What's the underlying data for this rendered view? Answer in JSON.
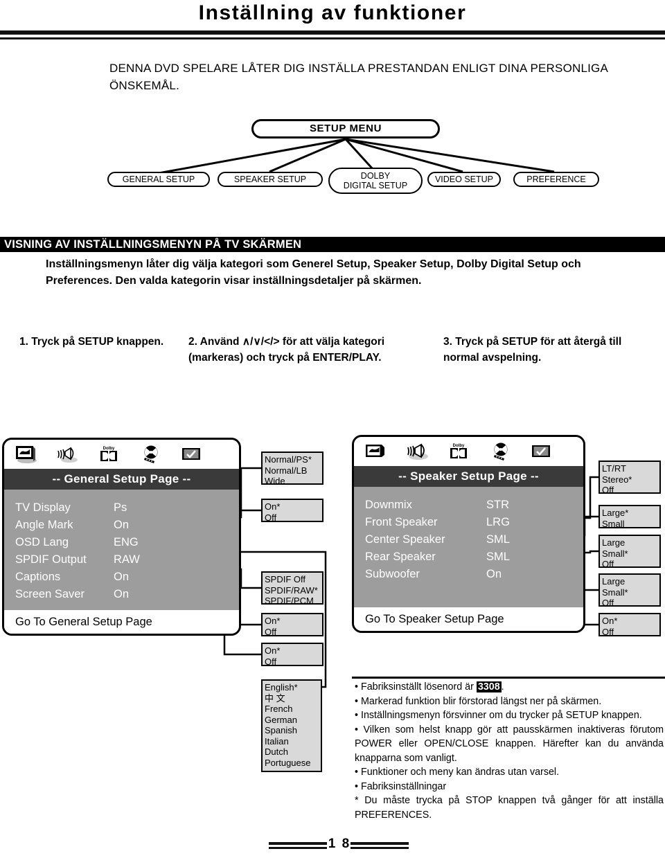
{
  "page": {
    "title": "Inställning av funktioner",
    "number": "1 8"
  },
  "intro": "DENNA DVD SPELARE LÅTER DIG INSTÄLLA PRESTANDAN ENLIGT DINA PERSONLIGA ÖNSKEMÅL.",
  "flow": {
    "root": "SETUP MENU",
    "nodes": [
      {
        "label": "GENERAL SETUP"
      },
      {
        "label": "SPEAKER SETUP"
      },
      {
        "label_line1": "DOLBY",
        "label_line2": "DIGITAL SETUP"
      },
      {
        "label": "VIDEO SETUP"
      },
      {
        "label": "PREFERENCE"
      }
    ]
  },
  "section": {
    "heading": "VISNING AV INSTÄLLNINGSMENYN PÅ TV SKÄRMEN",
    "body": "Inställningsmenyn låter dig välja kategori som Generel Setup, Speaker Setup, Dolby Digital Setup och Preferences. Den valda kategorin visar inställningsdetaljer på skärmen."
  },
  "steps": [
    {
      "text": "1. Tryck på SETUP knappen."
    },
    {
      "text": "2. Använd ∧/∨/</> för att välja kategori (markeras) och tryck på ENTER/PLAY."
    },
    {
      "text": "3. Tryck på SETUP för att återgå till normal avspelning."
    }
  ],
  "general_setup": {
    "title": "-- General Setup Page --",
    "icons": [
      "tv-icon",
      "speaker-icon",
      "dolby-icon",
      "film-reel-icon",
      "checkmark-icon"
    ],
    "rows": [
      {
        "label": "TV Display",
        "value": "Ps"
      },
      {
        "label": "Angle Mark",
        "value": "On"
      },
      {
        "label": "OSD Lang",
        "value": "ENG"
      },
      {
        "label": "SPDIF Output",
        "value": "RAW"
      },
      {
        "label": "Captions",
        "value": "On"
      },
      {
        "label": "Screen Saver",
        "value": "On"
      }
    ],
    "footer": "Go To General Setup Page"
  },
  "speaker_setup": {
    "title": "-- Speaker Setup Page --",
    "icons": [
      "tv-icon",
      "speaker-icon",
      "dolby-icon",
      "film-reel-icon",
      "checkmark-icon"
    ],
    "rows": [
      {
        "label": "Downmix",
        "value": "STR"
      },
      {
        "label": "Front Speaker",
        "value": "LRG"
      },
      {
        "label": "Center Speaker",
        "value": "SML"
      },
      {
        "label": "Rear Speaker",
        "value": "SML"
      },
      {
        "label": "Subwoofer",
        "value": "On"
      }
    ],
    "footer": "Go To Speaker Setup Page"
  },
  "option_boxes": {
    "tv_display": {
      "options": "Normal/PS*\nNormal/LB\nWide"
    },
    "angle_mark": {
      "options": "On*\nOff"
    },
    "spdif_output": {
      "options": "SPDIF Off\nSPDIF/RAW*\nSPDIF/PCM"
    },
    "captions": {
      "options": "On*\nOff"
    },
    "screen_saver": {
      "options": "On*\nOff"
    },
    "osd_lang": {
      "options": "English*\n中 文\nFrench\nGerman\nSpanish\nItalian\nDutch\nPortuguese"
    },
    "downmix": {
      "options": "LT/RT\nStereo*\nOff"
    },
    "front_speaker": {
      "options": "Large*\nSmall"
    },
    "center_speaker": {
      "options": "Large\nSmall*\nOff"
    },
    "rear_speaker": {
      "options": "Large\nSmall*\nOff"
    },
    "subwoofer": {
      "options": "On*\nOff"
    }
  },
  "notes": {
    "password_prefix": "• Fabriksinställt lösenord är ",
    "password_value": "3308",
    "password_suffix": ".",
    "items": [
      "• Markerad funktion blir förstorad längst ner på skärmen.",
      "• Inställningsmenyn försvinner  om du trycker på SETUP knappen.",
      "• Vilken som helst knapp gör att pausskärmen inaktiveras förutom POWER eller OPEN/CLOSE knappen. Härefter kan du använda knapparna som vanligt.",
      "• Funktioner och meny kan ändras utan varsel.",
      "• Fabriksinställningar",
      "* Du måste trycka på STOP knappen två gånger för att inställa PREFERENCES."
    ]
  },
  "colors": {
    "osd_header": "#3a3a3a",
    "osd_body": "#9d9d9d",
    "option_box": "#d9d9d9",
    "section_bar": "#000000"
  }
}
